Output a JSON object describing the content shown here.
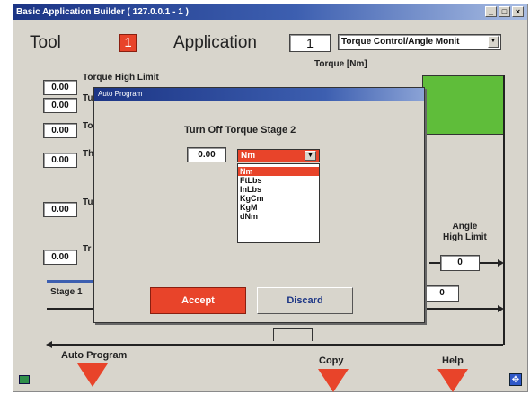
{
  "window": {
    "title": "Basic Application Builder  ( 127.0.0.1 - 1 )",
    "controls": [
      "_",
      "□",
      "×"
    ]
  },
  "header": {
    "tool_label": "Tool",
    "tool_number": "1",
    "application_label": "Application",
    "application_number": "1",
    "application_mode": "Torque Control/Angle Monit"
  },
  "params": {
    "torque_high_limit_value": "0.00",
    "torque_high_limit_label": "Torque High Limit",
    "row2_value": "0.00",
    "row2_label": "Tu",
    "row3_value": "0.00",
    "row3_label": "To",
    "row4_value": "0.00",
    "row4_label": "Th",
    "row5_value": "0.00",
    "row5_label": "Tu",
    "row6_value": "0.00",
    "row6_label": "Tr"
  },
  "graph": {
    "torque_unit_label": "Torque [Nm]",
    "angle_high_limit_label": "Angle\nHigh Limit",
    "angle_high_limit_value": "0",
    "angle_value_2": "0",
    "stage_label": "Stage 1"
  },
  "bottom": {
    "auto_program_label": "Auto Program",
    "copy_label": "Copy",
    "help_label": "Help"
  },
  "dialog": {
    "title": "Auto Program",
    "heading": "Turn Off Torque Stage 2",
    "value": "0.00",
    "selected_unit": "Nm",
    "unit_options": [
      "Nm",
      "FtLbs",
      "InLbs",
      "KgCm",
      "KgM",
      "dNm"
    ],
    "accept_label": "Accept",
    "discard_label": "Discard"
  },
  "colors": {
    "accent_red": "#e8442a",
    "green_zone": "#5fbd3a",
    "title_blue": "#1c3585",
    "background": "#d8d5cc"
  }
}
